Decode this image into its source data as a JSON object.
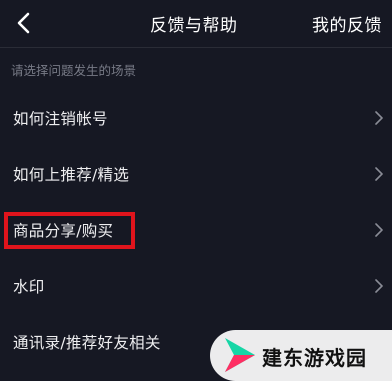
{
  "header": {
    "title": "反馈与帮助",
    "right_action": "我的反馈"
  },
  "section_hint": "请选择问题发生的场景",
  "items": [
    {
      "label": "如何注销帐号"
    },
    {
      "label": "如何上推荐/精选"
    },
    {
      "label": "商品分享/购买"
    },
    {
      "label": "水印"
    },
    {
      "label": "通讯录/推荐好友相关"
    }
  ],
  "highlighted_item_index": 2,
  "watermark": {
    "text": "建东游戏园"
  },
  "colors": {
    "background": "#161823",
    "highlight_border": "#e0141c",
    "hint_text": "#777a86",
    "logo_green": "#16d6a6",
    "logo_pink": "#ff2e63"
  }
}
